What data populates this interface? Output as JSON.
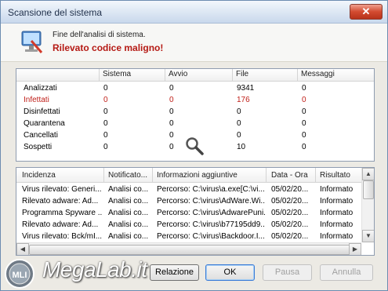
{
  "window": {
    "title": "Scansione del sistema",
    "close": "✕"
  },
  "header": {
    "message": "Fine dell'analisi di sistema.",
    "alert": "Rilevato codice maligno!"
  },
  "stats": {
    "columns": [
      "",
      "Sistema",
      "Avvio",
      "File",
      "Messaggi"
    ],
    "rows": [
      {
        "label": "Analizzati",
        "values": [
          "0",
          "0",
          "9341",
          "0"
        ],
        "highlight": false
      },
      {
        "label": "Infettati",
        "values": [
          "0",
          "0",
          "176",
          "0"
        ],
        "highlight": true
      },
      {
        "label": "Disinfettati",
        "values": [
          "0",
          "0",
          "0",
          "0"
        ],
        "highlight": false
      },
      {
        "label": "Quarantena",
        "values": [
          "0",
          "0",
          "0",
          "0"
        ],
        "highlight": false
      },
      {
        "label": "Cancellati",
        "values": [
          "0",
          "0",
          "0",
          "0"
        ],
        "highlight": false
      },
      {
        "label": "Sospetti",
        "values": [
          "0",
          "0",
          "10",
          "0"
        ],
        "highlight": false
      }
    ]
  },
  "log": {
    "columns": [
      "Incidenza",
      "Notificato...",
      "Informazioni aggiuntive",
      "Data - Ora",
      "Risultato"
    ],
    "rows": [
      [
        "Virus rilevato: Generi...",
        "Analisi co...",
        "Percorso: C:\\virus\\a.exe[C:\\vi...",
        "05/02/20...",
        "Informato"
      ],
      [
        "Rilevato adware: Ad...",
        "Analisi co...",
        "Percorso: C:\\virus\\AdWare.Wi...",
        "05/02/20...",
        "Informato"
      ],
      [
        "Programma Spyware ...",
        "Analisi co...",
        "Percorso: C:\\virus\\AdwarePuni...",
        "05/02/20...",
        "Informato"
      ],
      [
        "Rilevato adware: Ad...",
        "Analisi co...",
        "Percorso: C:\\virus\\b77195dd9...",
        "05/02/20...",
        "Informato"
      ],
      [
        "Virus rilevato: Bck/mI...",
        "Analisi co...",
        "Percorso: C:\\virus\\Backdoor.I...",
        "05/02/20...",
        "Informato"
      ]
    ]
  },
  "buttons": {
    "report": "Relazione",
    "ok": "OK",
    "pause": "Pausa",
    "cancel": "Annulla"
  },
  "watermark": {
    "text": "MegaLab.it",
    "badge": "MLI"
  },
  "colors": {
    "alert": "#b51a14",
    "infected": "#c0201a"
  },
  "icons": [
    "monitor-scan-icon",
    "magnifier-icon",
    "scroll-up-icon",
    "scroll-down-icon",
    "scroll-left-icon",
    "scroll-right-icon"
  ]
}
